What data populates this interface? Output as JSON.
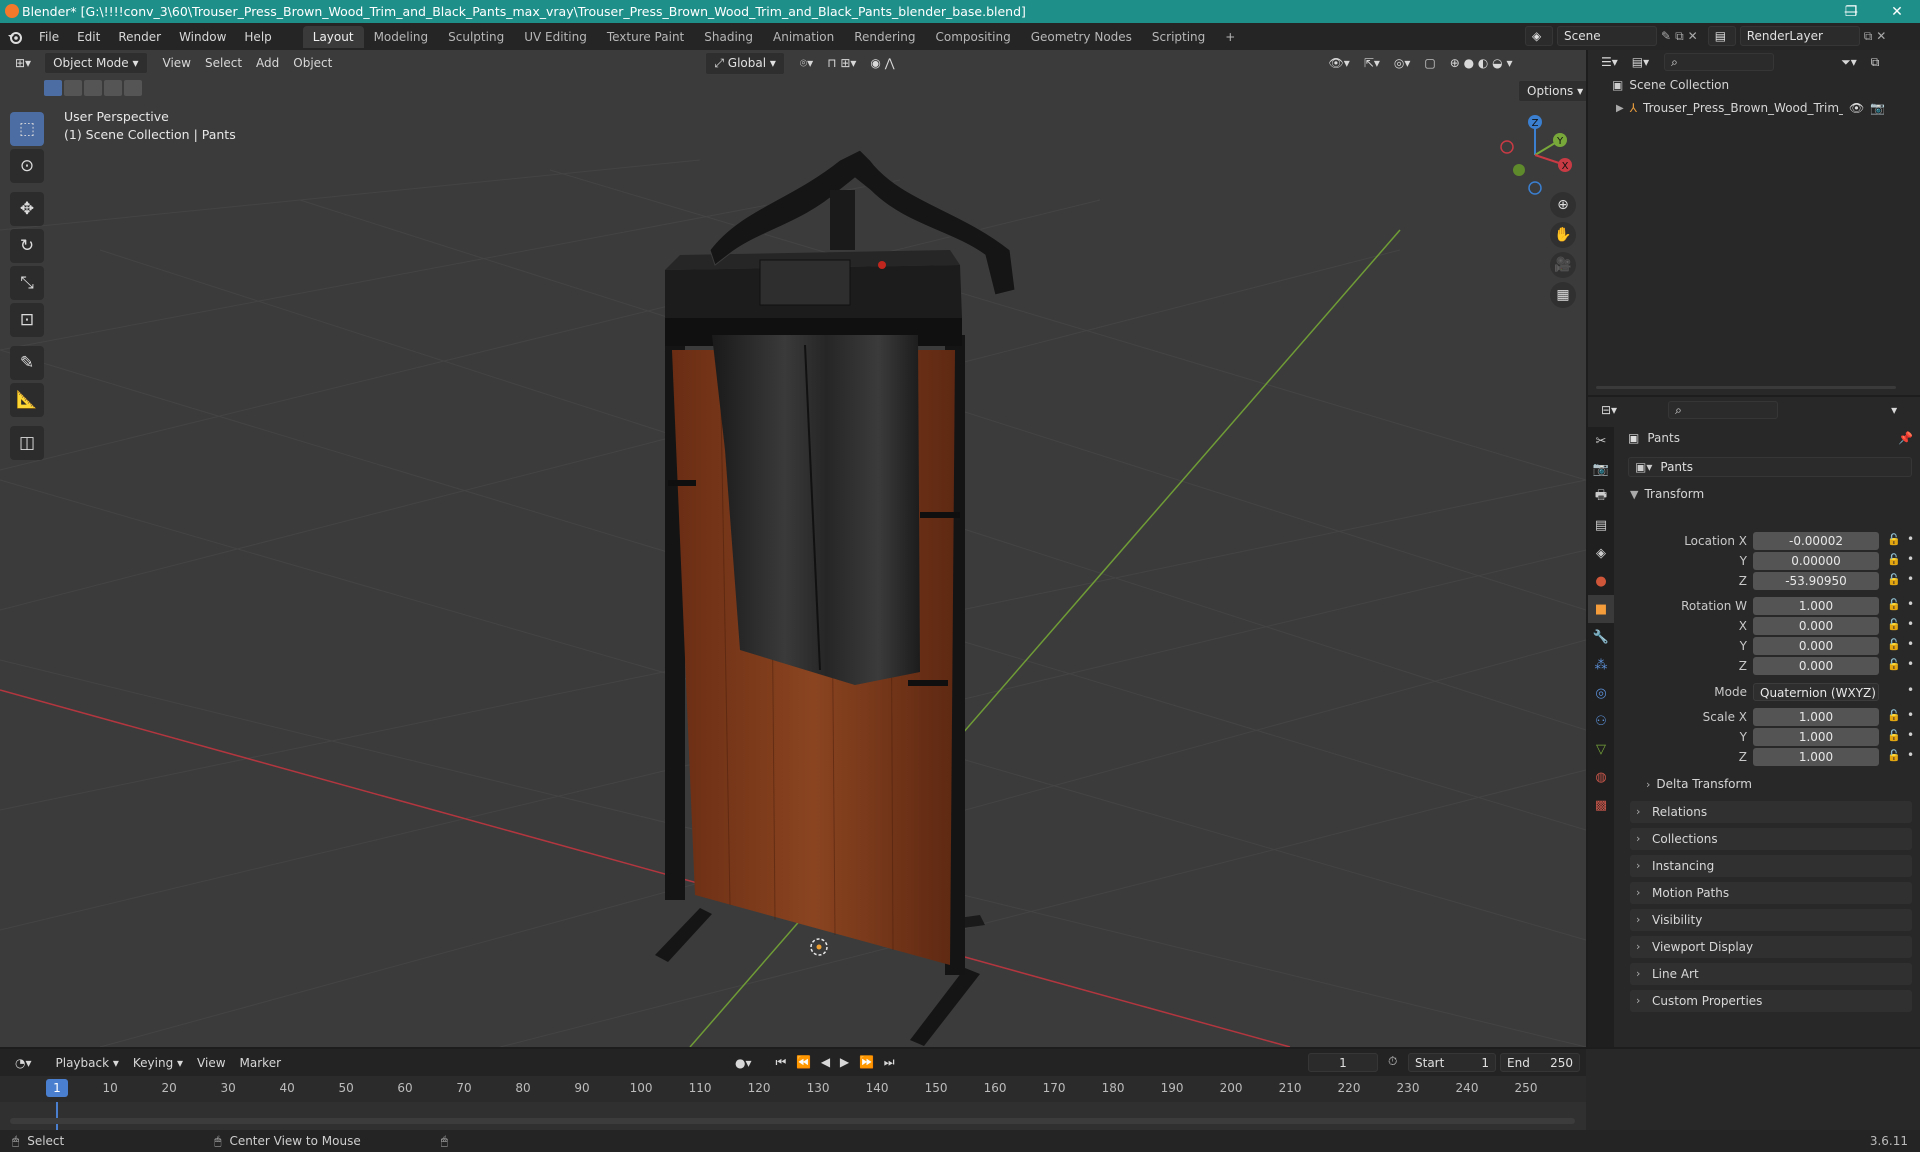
{
  "window": {
    "title": "Blender* [G:\\!!!!conv_3\\60\\Trouser_Press_Brown_Wood_Trim_and_Black_Pants_max_vray\\Trouser_Press_Brown_Wood_Trim_and_Black_Pants_blender_base.blend]",
    "controls": [
      "—",
      "❐",
      "✕"
    ]
  },
  "menu": [
    "File",
    "Edit",
    "Render",
    "Window",
    "Help"
  ],
  "workspaces": [
    "Layout",
    "Modeling",
    "Sculpting",
    "UV Editing",
    "Texture Paint",
    "Shading",
    "Animation",
    "Rendering",
    "Compositing",
    "Geometry Nodes",
    "Scripting"
  ],
  "active_workspace": "Layout",
  "add_workspace": "+",
  "scene": {
    "name": "Scene",
    "render_layer": "RenderLayer"
  },
  "viewport": {
    "mode": "Object Mode",
    "menus": [
      "View",
      "Select",
      "Add",
      "Object"
    ],
    "orientation": "Global",
    "options_label": "Options",
    "info_line1": "User Perspective",
    "info_line2": "(1) Scene Collection | Pants",
    "gizmo_axes": [
      "Z",
      "Y",
      "X"
    ]
  },
  "outliner": {
    "root": "Scene Collection",
    "item": "Trouser_Press_Brown_Wood_Trim_and_I"
  },
  "properties": {
    "object_name": "Pants",
    "data_name": "Pants",
    "transform_title": "Transform",
    "location": {
      "label_x": "Location X",
      "x": "-0.00002",
      "y": "0.00000",
      "z": "-53.90950"
    },
    "rotation": {
      "label_w": "Rotation W",
      "w": "1.000",
      "x": "0.000",
      "y": "0.000",
      "z": "0.000"
    },
    "axis_labels": {
      "x": "X",
      "y": "Y",
      "z": "Z"
    },
    "mode_label": "Mode",
    "mode_value": "Quaternion (WXYZ)",
    "scale": {
      "label_x": "Scale X",
      "x": "1.000",
      "y": "1.000",
      "z": "1.000"
    },
    "delta_transform": "Delta Transform",
    "panels": [
      "Relations",
      "Collections",
      "Instancing",
      "Motion Paths",
      "Visibility",
      "Viewport Display",
      "Line Art",
      "Custom Properties"
    ]
  },
  "timeline": {
    "menus": [
      "Playback",
      "Keying",
      "View",
      "Marker"
    ],
    "current_frame": "1",
    "start_label": "Start",
    "start": "1",
    "end_label": "End",
    "end": "250",
    "ticks": [
      "1",
      "10",
      "20",
      "30",
      "40",
      "50",
      "60",
      "70",
      "80",
      "90",
      "100",
      "110",
      "120",
      "130",
      "140",
      "150",
      "160",
      "170",
      "180",
      "190",
      "200",
      "210",
      "220",
      "230",
      "240",
      "250"
    ]
  },
  "status": {
    "select": "Select",
    "center_view": "Center View to Mouse",
    "version": "3.6.11"
  },
  "colors": {
    "title_bar": "#1f8f8a",
    "active_tool": "#4c6da3",
    "x_axis": "#c83a44",
    "y_axis": "#78a83a",
    "z_axis": "#3a7fd0",
    "wood": "#7a3a1c",
    "frame_cursor": "#4a7fd0"
  }
}
